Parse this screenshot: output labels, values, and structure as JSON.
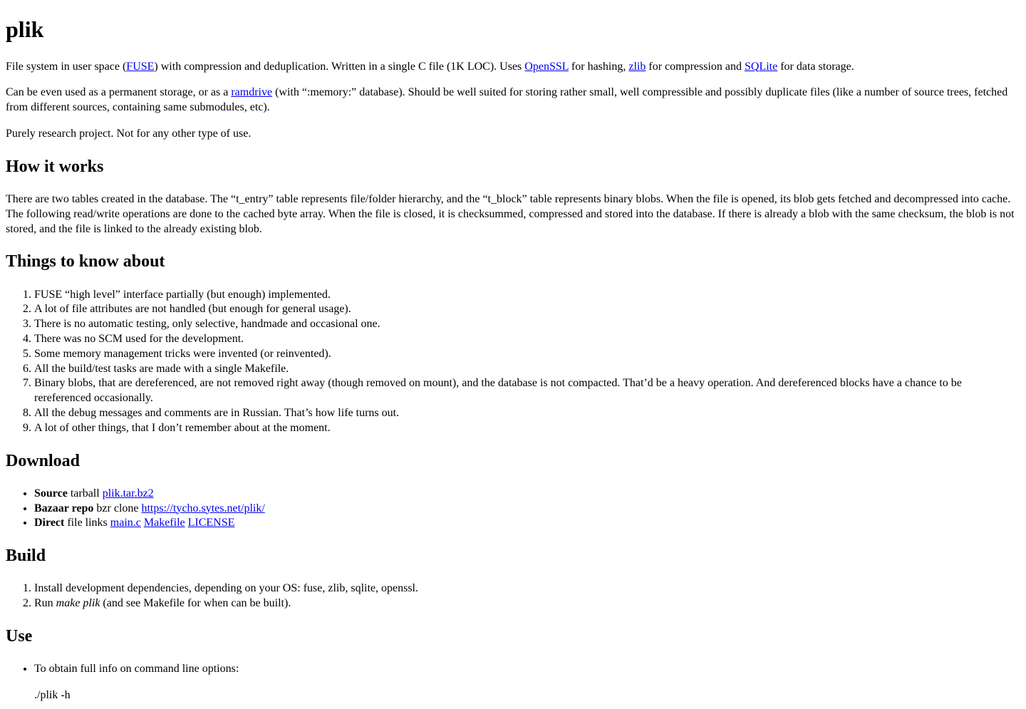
{
  "title": "plik",
  "intro": {
    "p1_a": "File system in user space (",
    "link_fuse": "FUSE",
    "p1_b": ") with compression and deduplication. Written in a single C file (1K LOC). Uses ",
    "link_openssl": "OpenSSL",
    "p1_c": " for hashing, ",
    "link_zlib": "zlib",
    "p1_d": " for compression and ",
    "link_sqlite": "SQLite",
    "p1_e": " for data storage.",
    "p2_a": "Can be even used as a permanent storage, or as a ",
    "link_ramdrive": "ramdrive",
    "p2_b": " (with “:memory:” database). Should be well suited for storing rather small, well compressible and possibly duplicate files (like a number of source trees, fetched from different sources, containing same submodules, etc).",
    "p3": "Purely research project. Not for any other type of use."
  },
  "how_heading": "How it works",
  "how_text": "There are two tables created in the database. The “t_entry” table represents file/folder hierarchy, and the “t_block” table represents binary blobs. When the file is opened, its blob gets fetched and decompressed into cache. The following read/write operations are done to the cached byte array. When the file is closed, it is checksummed, compressed and stored into the database. If there is already a blob with the same checksum, the blob is not stored, and the file is linked to the already existing blob.",
  "things_heading": "Things to know about",
  "things": [
    "FUSE “high level” interface partially (but enough) implemented.",
    "A lot of file attributes are not handled (but enough for general usage).",
    "There is no automatic testing, only selective, handmade and occasional one.",
    "There was no SCM used for the development.",
    "Some memory management tricks were invented (or reinvented).",
    "All the build/test tasks are made with a single Makefile.",
    "Binary blobs, that are dereferenced, are not removed right away (though removed on mount), and the database is not compacted. That’d be a heavy operation. And dereferenced blocks have a chance to be rereferenced occasionally.",
    "All the debug messages and comments are in Russian. That’s how life turns out.",
    "A lot of other things, that I don’t remember about at the moment."
  ],
  "download_heading": "Download",
  "download": {
    "source_strong": "Source",
    "source_text": " tarball ",
    "source_link": "plik.tar.bz2",
    "bazaar_strong": "Bazaar repo",
    "bazaar_text": " bzr clone ",
    "bazaar_link": "https://tycho.sytes.net/plik/",
    "direct_strong": "Direct",
    "direct_text": " file links ",
    "direct_link1": "main.c",
    "direct_link2": "Makefile",
    "direct_link3": "LICENSE"
  },
  "build_heading": "Build",
  "build": {
    "step1": "Install development dependencies, depending on your OS: fuse, zlib, sqlite, openssl.",
    "step2_a": "Run ",
    "step2_em": "make plik",
    "step2_b": " (and see Makefile for when can be built)."
  },
  "use_heading": "Use",
  "use": {
    "item1": "To obtain full info on command line options:",
    "code1": "./plik -h"
  }
}
